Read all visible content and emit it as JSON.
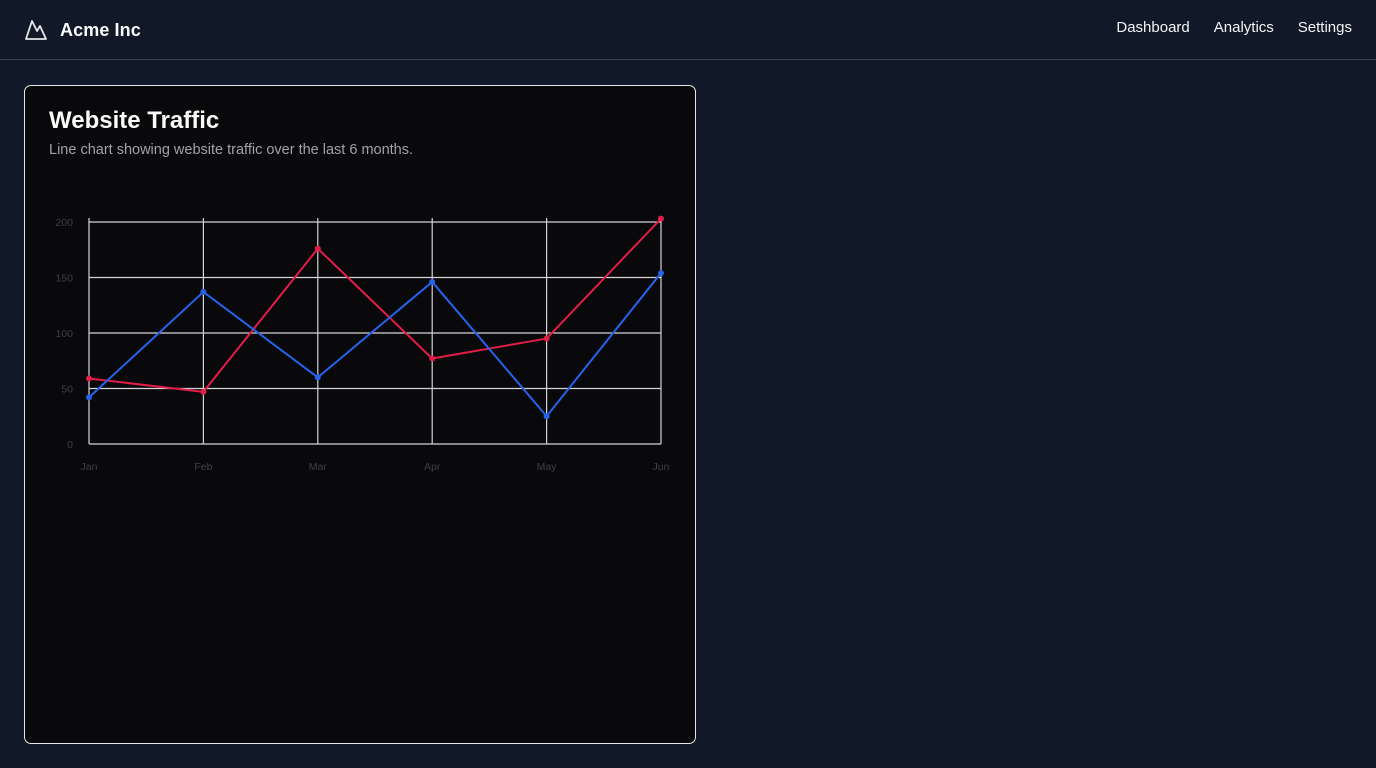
{
  "header": {
    "brand_name": "Acme Inc",
    "brand_icon": "mountain-icon",
    "nav": [
      {
        "label": "Dashboard"
      },
      {
        "label": "Analytics"
      },
      {
        "label": "Settings"
      }
    ]
  },
  "card": {
    "title": "Website Traffic",
    "description": "Line chart showing website traffic over the last 6 months."
  },
  "colors": {
    "background": "#111827",
    "card_background": "#09090b",
    "series_red": "#e11d48",
    "series_blue": "#2563eb"
  },
  "chart_data": {
    "type": "line",
    "title": "",
    "xlabel": "",
    "ylabel": "",
    "categories": [
      "Jan",
      "Feb",
      "Mar",
      "Apr",
      "May",
      "Jun"
    ],
    "y_ticks": [
      0,
      50,
      100,
      150,
      200
    ],
    "ylim": [
      0,
      200
    ],
    "grid": true,
    "series": [
      {
        "color": "#e11d48",
        "values": [
          59,
          47,
          176,
          77,
          95,
          203
        ]
      },
      {
        "color": "#2563eb",
        "values": [
          42,
          137,
          60,
          146,
          25,
          154
        ]
      }
    ]
  }
}
